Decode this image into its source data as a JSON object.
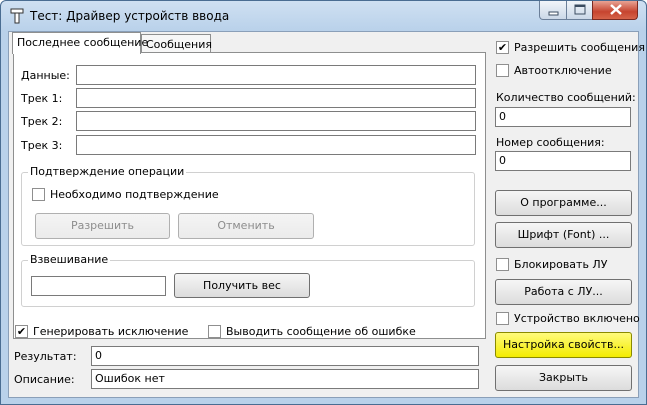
{
  "window": {
    "title": "Тест: Драйвер устройств ввода"
  },
  "tabs": [
    {
      "label": "Последнее сообщение"
    },
    {
      "label": "Сообщения"
    }
  ],
  "fields": {
    "data_label": "Данные:",
    "track1_label": "Трек 1:",
    "track2_label": "Трек 2:",
    "track3_label": "Трек 3:",
    "data_value": "",
    "track1_value": "",
    "track2_value": "",
    "track3_value": ""
  },
  "confirm_group": {
    "title": "Подтверждение операции",
    "checkbox_label": "Необходимо подтверждение",
    "checked": false,
    "allow_button": "Разрешить",
    "cancel_button": "Отменить"
  },
  "weigh_group": {
    "title": "Взвешивание",
    "weight_value": "",
    "get_weight_button": "Получить вес"
  },
  "bottom": {
    "gen_exception_label": "Генерировать исключение",
    "gen_exception_checked": true,
    "show_error_label": "Выводить сообщение об ошибке",
    "show_error_checked": false,
    "result_label": "Результат:",
    "result_value": "0",
    "description_label": "Описание:",
    "description_value": "Ошибок нет"
  },
  "right_panel": {
    "allow_messages_label": "Разрешить сообщения",
    "allow_messages_checked": true,
    "auto_disable_label": "Автоотключение",
    "auto_disable_checked": false,
    "message_count_label": "Количество сообщений:",
    "message_count_value": "0",
    "message_number_label": "Номер сообщения:",
    "message_number_value": "0",
    "about_button": "О программе...",
    "font_button": "Шрифт (Font) ...",
    "lock_lu_label": "Блокировать ЛУ",
    "lock_lu_checked": false,
    "work_lu_button": "Работа с ЛУ...",
    "device_enabled_label": "Устройство включено",
    "device_enabled_checked": false,
    "properties_button": "Настройка свойств...",
    "close_button": "Закрыть"
  },
  "colors": {
    "highlight_button": "#f4ec00",
    "titlebar": "#b9d1ea",
    "close_button": "#c6442f"
  }
}
